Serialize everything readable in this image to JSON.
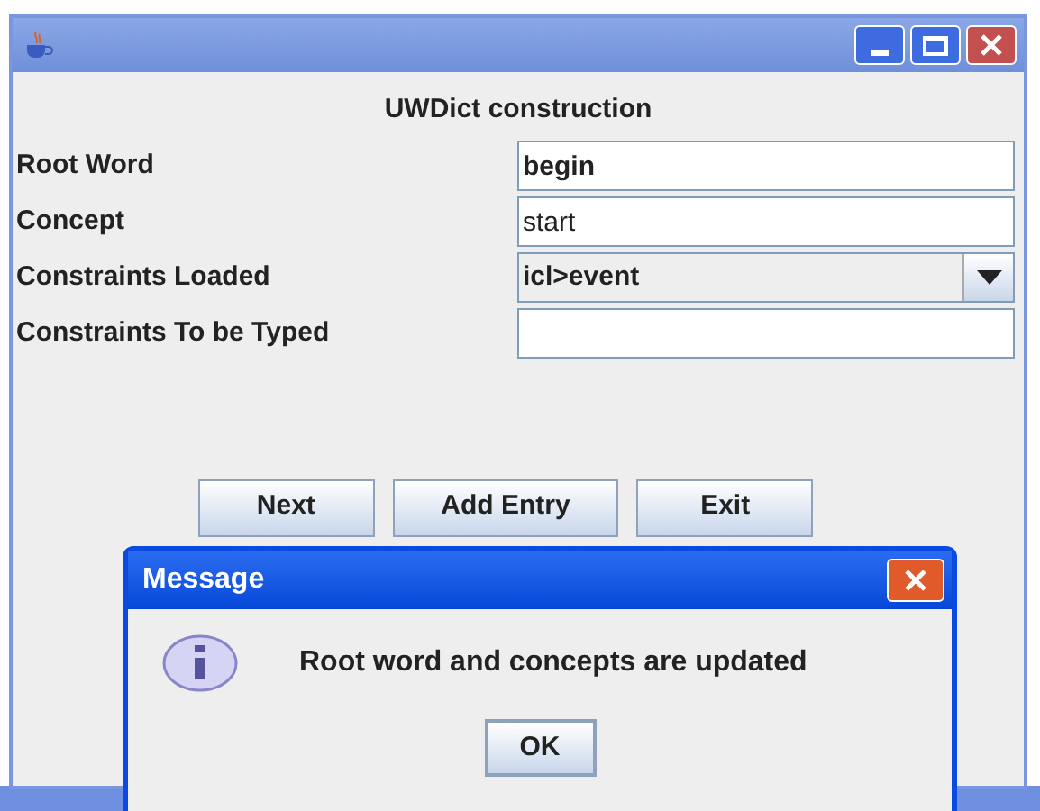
{
  "window": {
    "title": "UWDict construction"
  },
  "fields": [
    {
      "label": "Root Word",
      "kind": "text",
      "value": "begin",
      "bold": true
    },
    {
      "label": "Concept",
      "kind": "text",
      "value": "start",
      "bold": false
    },
    {
      "label": "Constraints Loaded",
      "kind": "combo",
      "value": "icl>event",
      "bold": true
    },
    {
      "label": "Constraints To be Typed",
      "kind": "text"
    }
  ],
  "buttons": [
    "Next",
    "Add Entry",
    "Exit"
  ],
  "dialog": {
    "title": "Message",
    "message": "Root word and concepts are updated",
    "button": "OK"
  }
}
